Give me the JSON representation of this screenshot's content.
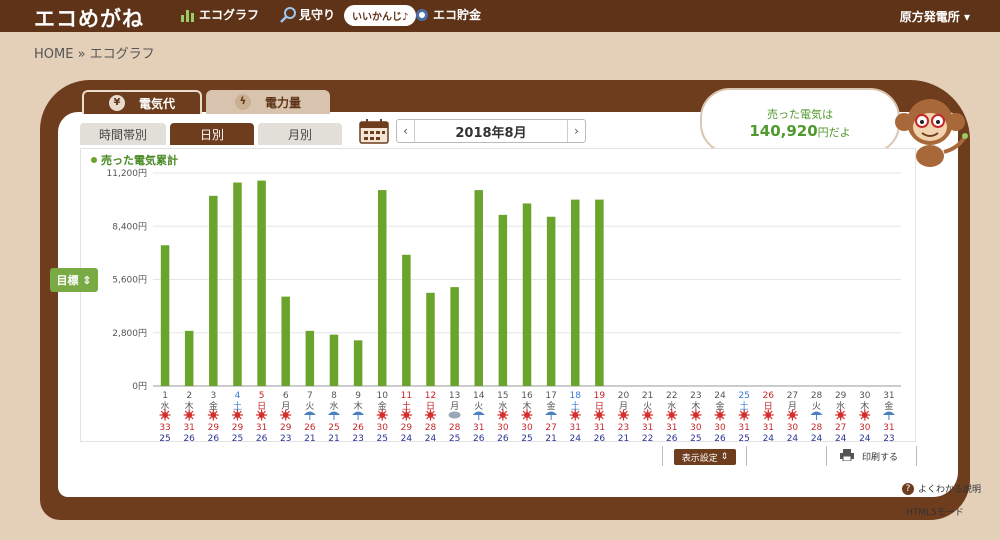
{
  "header": {
    "logo": "エコめがね",
    "nav": [
      {
        "label": "エコグラフ",
        "icon": "bar-graph-icon"
      },
      {
        "label": "見守り",
        "icon": "magnifier-icon"
      },
      {
        "label": "エコ貯金",
        "icon": "coin-icon"
      }
    ],
    "bubble": "いいかんじ♪",
    "plant": "原方発電所"
  },
  "breadcrumb": "HOME » エコグラフ",
  "main_tabs": [
    {
      "label": "電気代",
      "icon": "yen-icon"
    },
    {
      "label": "電力量",
      "icon": "lightning-icon"
    }
  ],
  "sub_tabs": [
    "時間帯別",
    "日別",
    "月別"
  ],
  "date": {
    "label": "2018年8月",
    "prev": "‹",
    "next": "›"
  },
  "cloud": {
    "line1": "売った電気は",
    "amount": "140,920",
    "suffix": "円だよ"
  },
  "goal_label": "目標",
  "footer": {
    "display_setting": "表示設定",
    "print": "印刷する",
    "help": "よくわかる説明",
    "html5": "HTML5モード"
  },
  "colors": {
    "bar": "#6aa42c",
    "brown": "#6e3d1d",
    "saturday": "#3a7bd5",
    "sunday": "#cc2222",
    "high": "#c62828",
    "low": "#283593"
  },
  "chart_data": {
    "type": "bar",
    "legend": "売った電気累計",
    "ylim": [
      0,
      11200
    ],
    "yticks": [
      "0円",
      "2,800円",
      "5,600円",
      "8,400円",
      "11,200円"
    ],
    "ytick_values": [
      0,
      2800,
      5600,
      8400,
      11200
    ],
    "days": [
      "1",
      "2",
      "3",
      "4",
      "5",
      "6",
      "7",
      "8",
      "9",
      "10",
      "11",
      "12",
      "13",
      "14",
      "15",
      "16",
      "17",
      "18",
      "19",
      "20",
      "21",
      "22",
      "23",
      "24",
      "25",
      "26",
      "27",
      "28",
      "29",
      "30",
      "31"
    ],
    "weekdays": [
      "水",
      "木",
      "金",
      "土",
      "日",
      "月",
      "火",
      "水",
      "木",
      "金",
      "土",
      "日",
      "月",
      "火",
      "水",
      "木",
      "金",
      "土",
      "日",
      "月",
      "火",
      "水",
      "木",
      "金",
      "土",
      "日",
      "月",
      "火",
      "水",
      "木",
      "金"
    ],
    "day_type": [
      "w",
      "w",
      "w",
      "sat",
      "sun",
      "w",
      "w",
      "w",
      "w",
      "w",
      "hol",
      "sun",
      "w",
      "w",
      "w",
      "w",
      "w",
      "sat",
      "sun",
      "w",
      "w",
      "w",
      "w",
      "w",
      "sat",
      "sun",
      "w",
      "w",
      "w",
      "w",
      "w"
    ],
    "values": [
      7400,
      2900,
      10000,
      10700,
      10800,
      4700,
      2900,
      2700,
      2400,
      10300,
      6900,
      4900,
      5200,
      10300,
      9000,
      9600,
      8900,
      9800,
      9800,
      null,
      null,
      null,
      null,
      null,
      null,
      null,
      null,
      null,
      null,
      null,
      null
    ],
    "weather": [
      "sun",
      "sun",
      "sun",
      "sun",
      "sun",
      "sun",
      "rain",
      "rain",
      "rain",
      "sun",
      "sun",
      "sun",
      "cloud",
      "rain",
      "sun",
      "sun",
      "rain",
      "sun",
      "sun",
      "sun",
      "sun",
      "sun",
      "sun",
      "sun",
      "sun",
      "sun",
      "sun",
      "rain",
      "sun",
      "sun",
      "rain"
    ],
    "high": [
      "33",
      "31",
      "29",
      "29",
      "31",
      "29",
      "26",
      "25",
      "26",
      "30",
      "29",
      "28",
      "28",
      "31",
      "30",
      "30",
      "27",
      "31",
      "31",
      "23",
      "31",
      "31",
      "30",
      "30",
      "31",
      "31",
      "30",
      "28",
      "27",
      "30",
      "31"
    ],
    "low": [
      "25",
      "26",
      "26",
      "25",
      "26",
      "23",
      "21",
      "21",
      "23",
      "25",
      "24",
      "24",
      "25",
      "26",
      "26",
      "25",
      "21",
      "24",
      "26",
      "21",
      "22",
      "26",
      "25",
      "26",
      "25",
      "24",
      "24",
      "24",
      "24",
      "24",
      "23"
    ]
  }
}
